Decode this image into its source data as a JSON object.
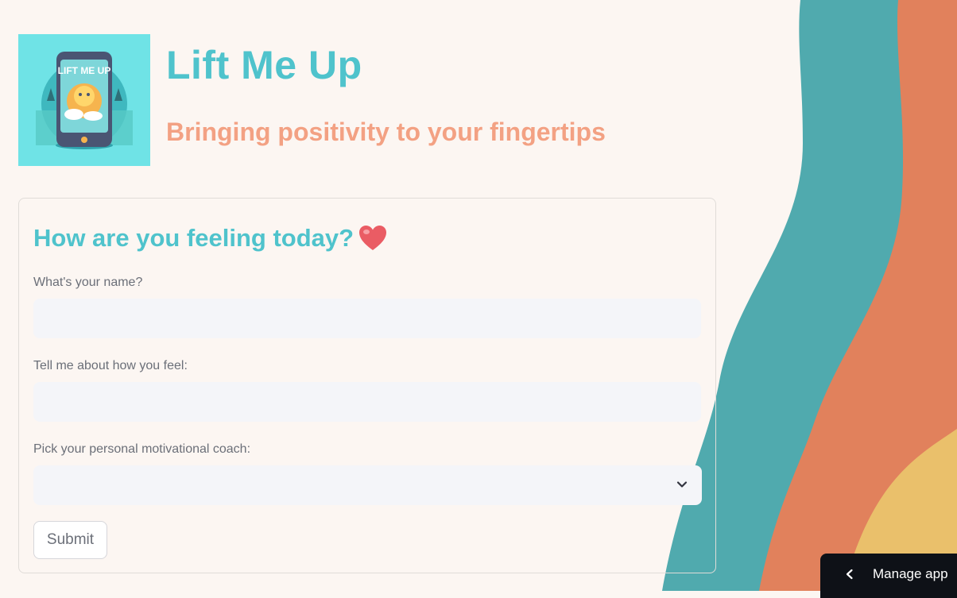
{
  "header": {
    "title": "Lift Me Up",
    "subtitle": "Bringing positivity to your fingertips",
    "logo_text": "LIFT ME UP"
  },
  "form": {
    "heading": "How are you feeling today?",
    "heading_icon": "red-heart-emoji",
    "name_label": "What's your name?",
    "name_value": "",
    "feeling_label": "Tell me about how you feel:",
    "feeling_value": "",
    "coach_label": "Pick your personal motivational coach:",
    "coach_selected": "",
    "submit_label": "Submit"
  },
  "footer": {
    "manage_app_label": "Manage app",
    "manage_app_icon": "chevron-left-icon"
  },
  "colors": {
    "background": "#fcf6f2",
    "title": "#4fc3cc",
    "subtitle": "#f3a183",
    "wave_teal": "#50aaae",
    "wave_orange": "#e1815c",
    "wave_yellow": "#eac06b",
    "input_bg": "#f4f5f9",
    "manage_bar": "#0e1117"
  }
}
